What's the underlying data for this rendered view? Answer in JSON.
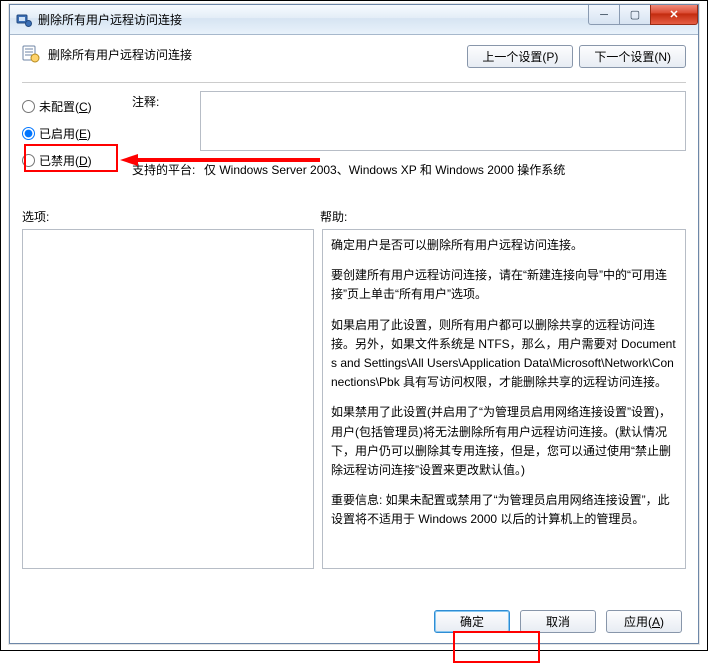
{
  "window": {
    "title": "删除所有用户远程访问连接"
  },
  "header": {
    "title": "删除所有用户远程访问连接",
    "prev_label": "上一个设置(P)",
    "next_label": "下一个设置(N)"
  },
  "radios": {
    "not_configured": "未配置(C)",
    "enabled": "已启用(E)",
    "disabled": "已禁用(D)",
    "selected": "enabled"
  },
  "fields": {
    "comment_label": "注释:",
    "comment_value": "",
    "platforms_label": "支持的平台:",
    "platforms_value": "仅 Windows Server 2003、Windows XP 和 Windows 2000 操作系统"
  },
  "panes": {
    "options_label": "选项:",
    "help_label": "帮助:",
    "help_paragraphs": [
      "确定用户是否可以删除所有用户远程访问连接。",
      "要创建所有用户远程访问连接，请在“新建连接向导”中的“可用连接”页上单击“所有用户”选项。",
      "如果启用了此设置，则所有用户都可以删除共享的远程访问连接。另外，如果文件系统是 NTFS，那么，用户需要对 Documents and Settings\\All Users\\Application Data\\Microsoft\\Network\\Connections\\Pbk 具有写访问权限，才能删除共享的远程访问连接。",
      "如果禁用了此设置(并启用了“为管理员启用网络连接设置”设置)，用户(包括管理员)将无法删除所有用户远程访问连接。(默认情况下，用户仍可以删除其专用连接，但是，您可以通过使用“禁止删除远程访问连接”设置来更改默认值。)",
      "重要信息: 如果未配置或禁用了“为管理员启用网络连接设置”，此设置将不适用于 Windows 2000 以后的计算机上的管理员。"
    ]
  },
  "buttons": {
    "ok": "确定",
    "cancel": "取消",
    "apply": "应用(A)"
  }
}
